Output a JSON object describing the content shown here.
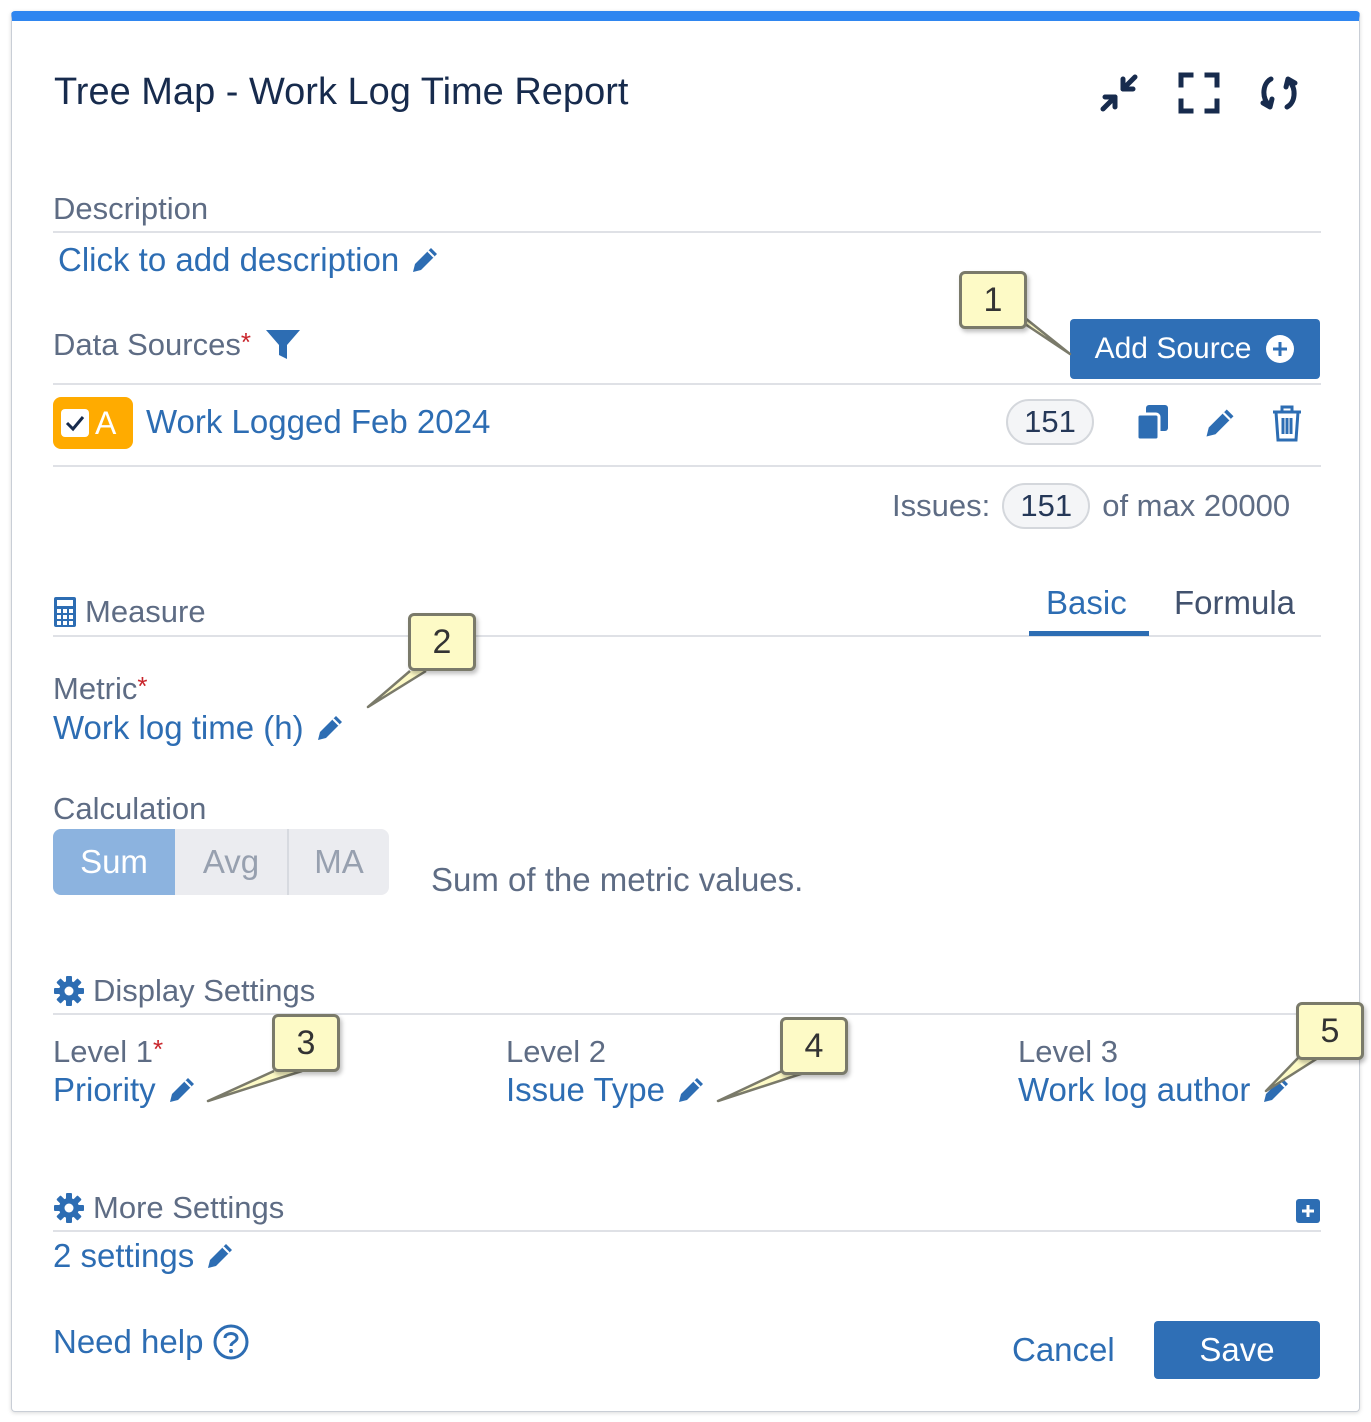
{
  "header": {
    "title": "Tree Map - Work Log Time Report"
  },
  "description": {
    "label": "Description",
    "link": "Click to add description"
  },
  "data_sources": {
    "label": "Data Sources",
    "required_mark": "*",
    "add_button": "Add Source",
    "source": {
      "badge_letter": "A",
      "name": "Work Logged Feb 2024",
      "count": "151"
    },
    "issues_label": "Issues:",
    "issues_count": "151",
    "issues_max": "of max 20000"
  },
  "measure": {
    "label": "Measure",
    "tabs": [
      {
        "label": "Basic",
        "active": true
      },
      {
        "label": "Formula",
        "active": false
      }
    ],
    "metric_label": "Metric",
    "metric_required": "*",
    "metric_value": "Work log time (h)",
    "calculation_label": "Calculation",
    "calculation_options": [
      "Sum",
      "Avg",
      "MA"
    ],
    "calculation_selected": "Sum",
    "calculation_hint": "Sum of the metric values."
  },
  "display_settings": {
    "label": "Display Settings",
    "levels": [
      {
        "label": "Level 1",
        "required": "*",
        "value": "Priority"
      },
      {
        "label": "Level 2",
        "required": "",
        "value": "Issue Type"
      },
      {
        "label": "Level 3",
        "required": "",
        "value": "Work log author"
      }
    ]
  },
  "more_settings": {
    "label": "More Settings",
    "link": "2 settings"
  },
  "footer": {
    "help": "Need help",
    "cancel": "Cancel",
    "save": "Save"
  },
  "callouts": [
    "1",
    "2",
    "3",
    "4",
    "5"
  ],
  "colors": {
    "accent_bar": "#2f86f0",
    "primary_button": "#2f6fb6",
    "link": "#2d6db3",
    "badge": "#ffab00",
    "callout_fill": "#fdfac6"
  },
  "icons": {
    "collapse": "collapse-arrows-icon",
    "fullscreen": "fullscreen-icon",
    "refresh": "refresh-icon",
    "filter": "filter-funnel-icon",
    "copy": "copy-icon",
    "edit": "pencil-icon",
    "delete": "trash-icon",
    "calculator": "calculator-icon",
    "gear": "gear-icon",
    "expand": "plus-square-icon",
    "help": "question-circle-icon"
  }
}
